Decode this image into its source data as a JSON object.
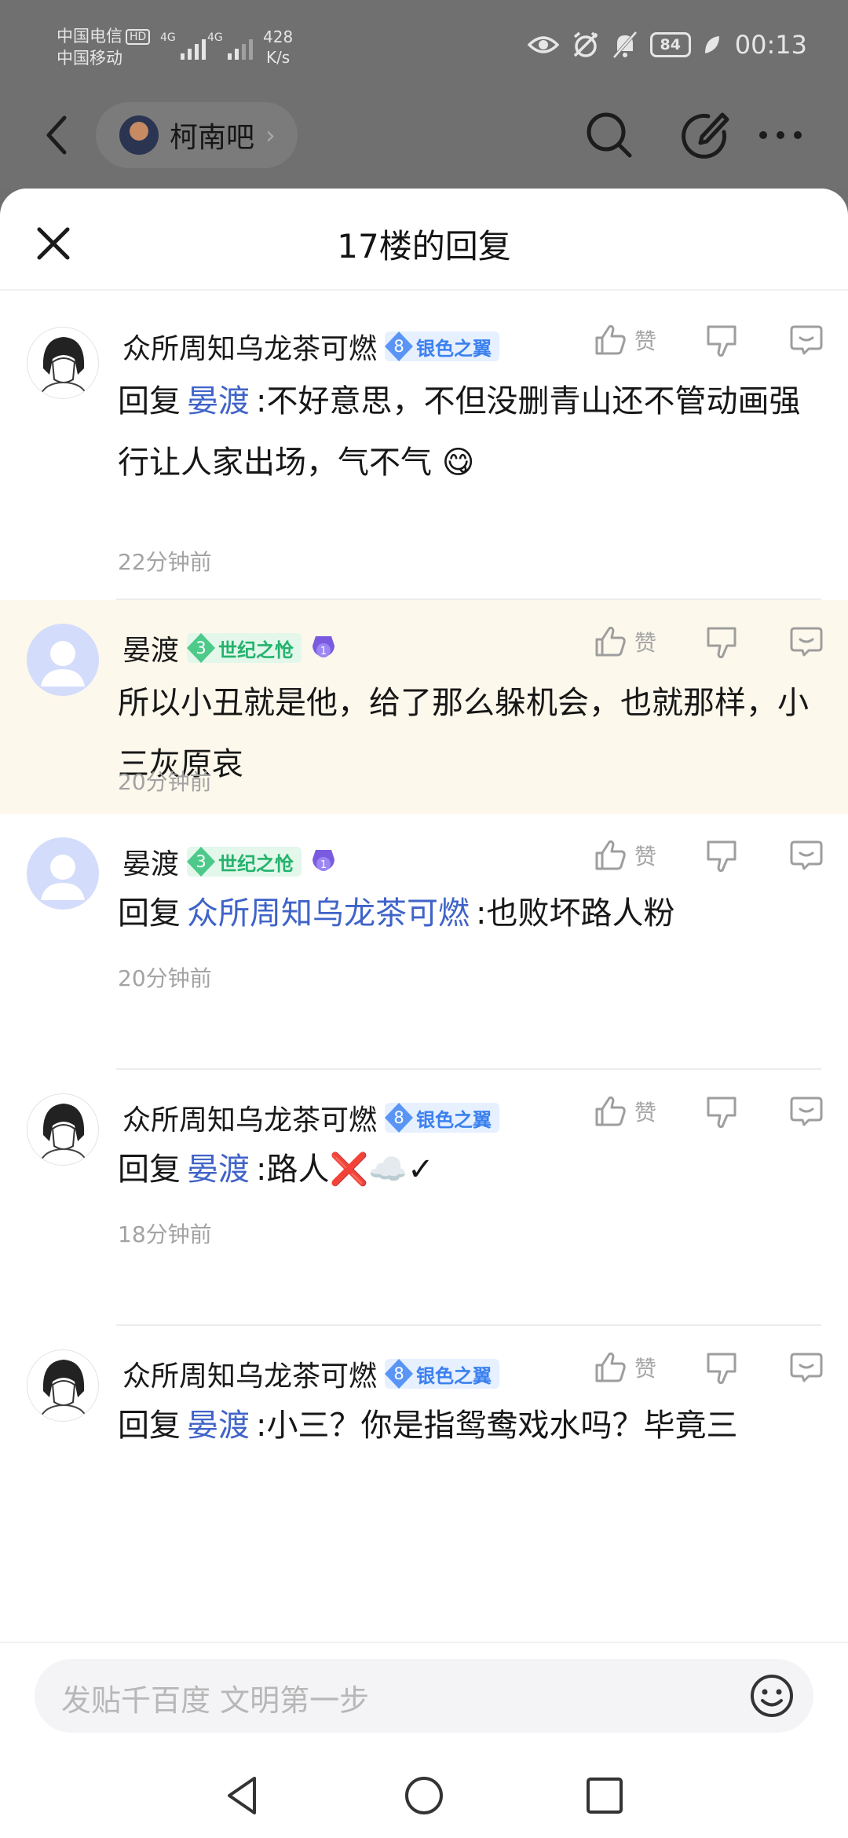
{
  "status_bar": {
    "carrier1": "中国电信",
    "hd": "HD",
    "carrier2": "中国移动",
    "net1": "4G",
    "net2": "4G",
    "speed_value": "428",
    "speed_unit": "K/s",
    "battery": "84",
    "time": "00:13"
  },
  "topnav": {
    "forum_name": "柯南吧"
  },
  "sheet": {
    "title": "17楼的回复"
  },
  "replies": [
    {
      "avatar": "manga-avatar",
      "username": "众所周知乌龙茶可燃",
      "level": "8",
      "level_title": "银色之翼",
      "like_label": "赞",
      "prefix": "回复",
      "mention": "晏渡",
      "text": ":不好意思，不但没删青山还不管动画强行让人家出场，气不气 😋",
      "time": "22分钟前",
      "highlighted": false
    },
    {
      "avatar": "default-avatar",
      "username": "晏渡",
      "level": "3",
      "level_title": "世纪之怆",
      "like_label": "赞",
      "text": "所以小丑就是他，给了那么躲机会，也就那样，小三灰原哀",
      "time": "20分钟前",
      "highlighted": true
    },
    {
      "avatar": "default-avatar",
      "username": "晏渡",
      "level": "3",
      "level_title": "世纪之怆",
      "like_label": "赞",
      "prefix": "回复",
      "mention": "众所周知乌龙茶可燃",
      "text": ":也败坏路人粉",
      "time": "20分钟前",
      "highlighted": false
    },
    {
      "avatar": "manga-avatar",
      "username": "众所周知乌龙茶可燃",
      "level": "8",
      "level_title": "银色之翼",
      "like_label": "赞",
      "prefix": "回复",
      "mention": "晏渡",
      "text": ":路人❌☁️✓",
      "time": "18分钟前",
      "highlighted": false
    },
    {
      "avatar": "manga-avatar",
      "username": "众所周知乌龙茶可燃",
      "level": "8",
      "level_title": "银色之翼",
      "like_label": "赞",
      "prefix": "回复",
      "mention": "晏渡",
      "text": ":小三？你是指鸳鸯戏水吗？毕竟三",
      "highlighted": false
    }
  ],
  "input": {
    "placeholder": "发贴千百度 文明第一步"
  },
  "colors": {
    "mention": "#3f63c8",
    "highlight_bg": "#fdf8ec",
    "level_blue": "#3b80f0",
    "level_green": "#24b36c"
  }
}
